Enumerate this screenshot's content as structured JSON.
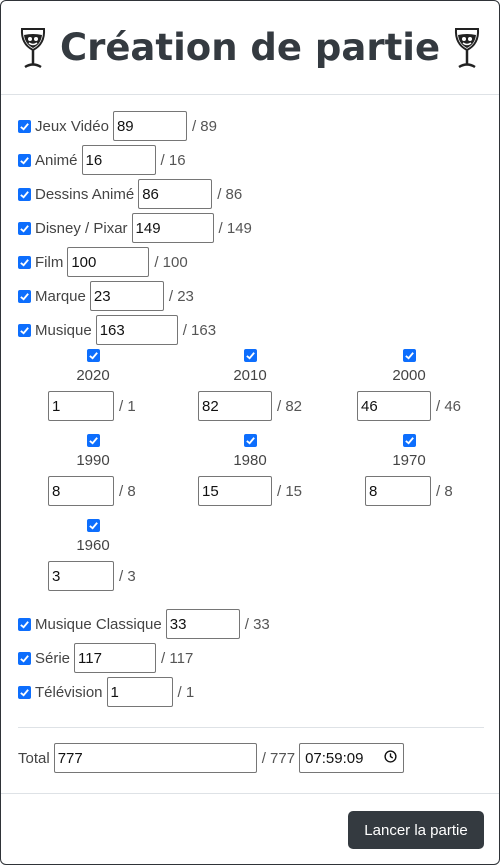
{
  "header": {
    "title": "Création de partie",
    "left_icon": "wine-glass-icon",
    "right_icon": "wine-glass-icon"
  },
  "categories": [
    {
      "label": "Jeux Vidéo",
      "value": "89",
      "max": "/ 89",
      "checked": true
    },
    {
      "label": "Animé",
      "value": "16",
      "max": "/ 16",
      "checked": true
    },
    {
      "label": "Dessins Animé",
      "value": "86",
      "max": "/ 86",
      "checked": true
    },
    {
      "label": "Disney / Pixar",
      "value": "149",
      "max": "/ 149",
      "checked": true
    },
    {
      "label": "Film",
      "value": "100",
      "max": "/ 100",
      "checked": true
    },
    {
      "label": "Marque",
      "value": "23",
      "max": "/ 23",
      "checked": true
    },
    {
      "label": "Musique",
      "value": "163",
      "max": "/ 163",
      "checked": true
    }
  ],
  "musique_decades": [
    {
      "year": "2020",
      "value": "1",
      "max": "/ 1",
      "checked": true
    },
    {
      "year": "2010",
      "value": "82",
      "max": "/ 82",
      "checked": true
    },
    {
      "year": "2000",
      "value": "46",
      "max": "/ 46",
      "checked": true
    },
    {
      "year": "1990",
      "value": "8",
      "max": "/ 8",
      "checked": true
    },
    {
      "year": "1980",
      "value": "15",
      "max": "/ 15",
      "checked": true
    },
    {
      "year": "1970",
      "value": "8",
      "max": "/ 8",
      "checked": true
    },
    {
      "year": "1960",
      "value": "3",
      "max": "/ 3",
      "checked": true
    }
  ],
  "categories_after": [
    {
      "label": "Musique Classique",
      "value": "33",
      "max": "/ 33",
      "checked": true
    },
    {
      "label": "Série",
      "value": "117",
      "max": "/ 117",
      "checked": true
    },
    {
      "label": "Télévision",
      "value": "1",
      "max": "/ 1",
      "checked": true
    }
  ],
  "total": {
    "label": "Total",
    "value": "777",
    "max": "/ 777",
    "time": "07:59:09",
    "time_icon": "clock-icon"
  },
  "footer": {
    "launch_label": "Lancer la partie"
  },
  "colors": {
    "checkbox": "#0d6efd",
    "button": "#343a40",
    "title": "#343a40"
  }
}
